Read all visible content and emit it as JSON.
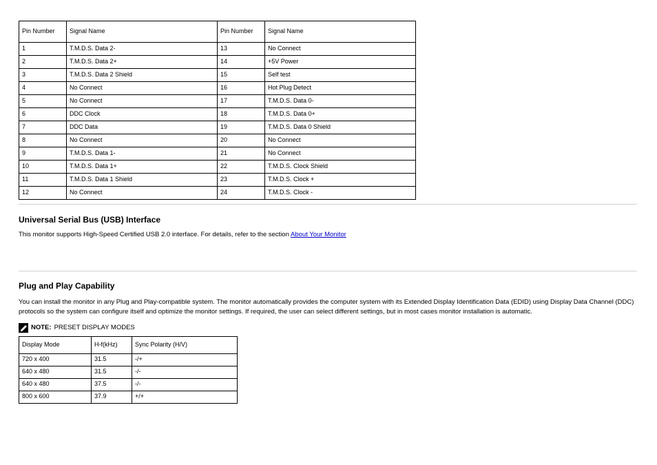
{
  "signal_table": {
    "headers": {
      "pin": "Pin Number",
      "signal": "Signal Name"
    },
    "left": [
      {
        "pin": "1",
        "signal": "T.M.D.S. Data 2-"
      },
      {
        "pin": "2",
        "signal": "T.M.D.S. Data 2+"
      },
      {
        "pin": "3",
        "signal": "T.M.D.S. Data 2 Shield"
      },
      {
        "pin": "4",
        "signal": "No Connect"
      },
      {
        "pin": "5",
        "signal": "No Connect"
      },
      {
        "pin": "6",
        "signal": "DDC Clock"
      },
      {
        "pin": "7",
        "signal": "DDC Data"
      },
      {
        "pin": "8",
        "signal": "No Connect"
      },
      {
        "pin": "9",
        "signal": "T.M.D.S. Data 1-"
      },
      {
        "pin": "10",
        "signal": "T.M.D.S. Data 1+"
      },
      {
        "pin": "11",
        "signal": "T.M.D.S. Data 1 Shield"
      },
      {
        "pin": "12",
        "signal": "No Connect"
      }
    ],
    "right": [
      {
        "pin": "13",
        "signal": "No Connect"
      },
      {
        "pin": "14",
        "signal": "+5V Power"
      },
      {
        "pin": "15",
        "signal": "Self test"
      },
      {
        "pin": "16",
        "signal": "Hot Plug Detect"
      },
      {
        "pin": "17",
        "signal": "T.M.D.S. Data 0-"
      },
      {
        "pin": "18",
        "signal": "T.M.D.S. Data 0+"
      },
      {
        "pin": "19",
        "signal": "T.M.D.S. Data 0 Shield"
      },
      {
        "pin": "20",
        "signal": "No Connect"
      },
      {
        "pin": "21",
        "signal": "No Connect"
      },
      {
        "pin": "22",
        "signal": "T.M.D.S. Clock Shield"
      },
      {
        "pin": "23",
        "signal": "T.M.D.S. Clock +"
      },
      {
        "pin": "24",
        "signal": "T.M.D.S. Clock -"
      }
    ]
  },
  "usb_section": {
    "heading": "Universal Serial Bus (USB) Interface",
    "body_prefix": "This monitor supports High-Speed Certified USB 2.0 interface. For details, refer to the section ",
    "link_text": "About Your Monitor",
    "body_suffix": ""
  },
  "pnp_section": {
    "heading": "Plug and Play Capability",
    "body": "You can install the monitor in any Plug and Play-compatible system. The monitor automatically provides the computer system with its Extended Display Identification Data (EDID) using Display Data Channel (DDC) protocols so the system can configure itself and optimize the monitor settings. If required, the user can select different settings, but in most cases monitor installation is automatic.",
    "note_label": "NOTE:",
    "note_text": "PRESET DISPLAY MODES",
    "preset_table": {
      "headers": {
        "mode": "Display Mode",
        "hf": "H-f(kHz)",
        "sync": "Sync Polarity (H/V)"
      },
      "rows": [
        {
          "mode": "720 x 400",
          "hf": "31.5",
          "sync": "-/+"
        },
        {
          "mode": "640 x 480",
          "hf": "31.5",
          "sync": "-/-"
        },
        {
          "mode": "640 x 480",
          "hf": "37.5",
          "sync": "-/-"
        },
        {
          "mode": "800 x 600",
          "hf": "37.9",
          "sync": "+/+"
        }
      ]
    }
  }
}
